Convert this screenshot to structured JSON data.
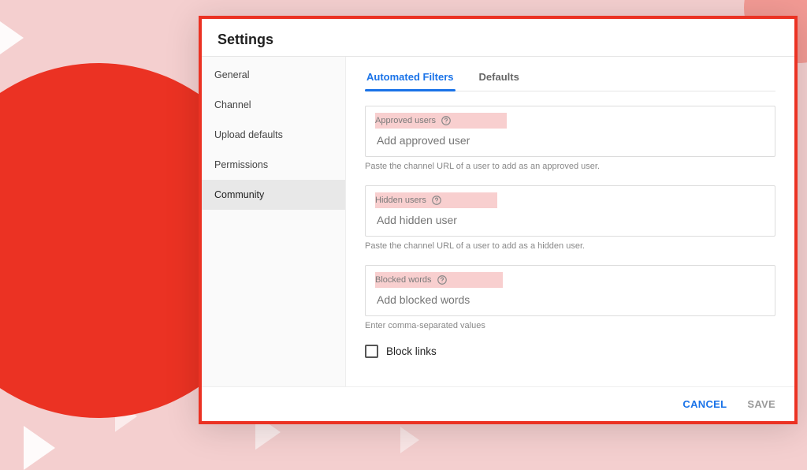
{
  "colors": {
    "accent_red": "#eb3223",
    "accent_blue": "#1a73e8"
  },
  "window": {
    "title": "Settings"
  },
  "sidebar": {
    "items": [
      {
        "label": "General"
      },
      {
        "label": "Channel"
      },
      {
        "label": "Upload defaults"
      },
      {
        "label": "Permissions"
      },
      {
        "label": "Community"
      }
    ],
    "selected_index": 4
  },
  "tabs": [
    {
      "label": "Automated Filters",
      "active": true
    },
    {
      "label": "Defaults",
      "active": false
    }
  ],
  "fields": {
    "approved": {
      "label": "Approved users",
      "placeholder": "Add approved user",
      "hint": "Paste the channel URL of a user to add as an approved user."
    },
    "hidden": {
      "label": "Hidden users",
      "placeholder": "Add hidden user",
      "hint": "Paste the channel URL of a user to add as a hidden user."
    },
    "blocked": {
      "label": "Blocked words",
      "placeholder": "Add blocked words",
      "hint": "Enter comma-separated values"
    }
  },
  "block_links": {
    "label": "Block links",
    "checked": false
  },
  "footer": {
    "cancel": "CANCEL",
    "save": "SAVE"
  }
}
